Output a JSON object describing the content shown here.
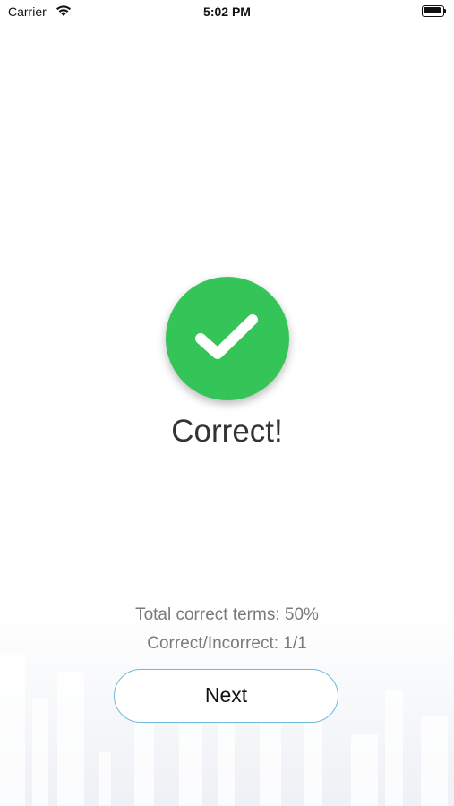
{
  "status_bar": {
    "carrier": "Carrier",
    "time": "5:02 PM"
  },
  "result": {
    "icon": "checkmark-icon",
    "title": "Correct!",
    "color": "#34c457"
  },
  "stats": {
    "total_correct": "Total correct terms: 50%",
    "correct_incorrect": "Correct/Incorrect: 1/1"
  },
  "next_button": {
    "label": "Next",
    "border_color": "#72b8d8"
  }
}
